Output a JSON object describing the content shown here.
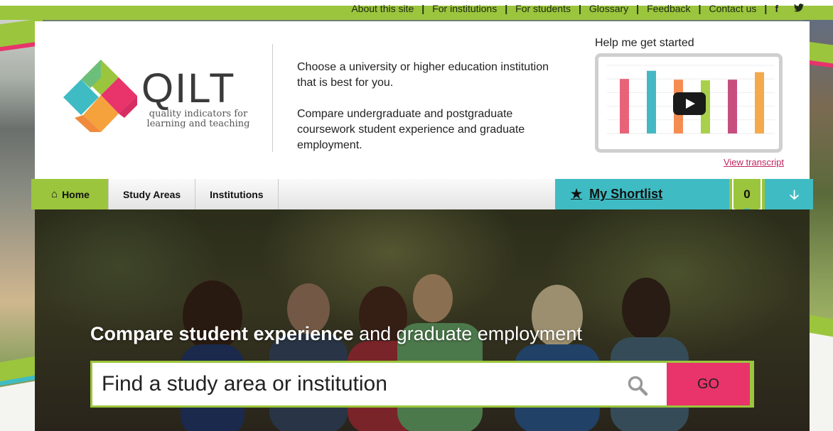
{
  "utility_nav": {
    "links": [
      "About this site",
      "For institutions",
      "For students",
      "Glossary",
      "Feedback",
      "Contact us"
    ],
    "social": [
      "f",
      "twitter"
    ]
  },
  "logo": {
    "wordmark": "QILT",
    "subtitle": "quality indicators for learning and teaching"
  },
  "intro": {
    "line1": "Choose a university or higher education institution that is best for you.",
    "line2": "Compare undergraduate and postgraduate coursework student experience and graduate employment."
  },
  "help": {
    "title": "Help me get started",
    "transcript": "View transcript",
    "video_thumbnail_chart": {
      "type": "bar",
      "values": [
        80,
        92,
        79,
        78,
        79,
        90
      ],
      "colors": [
        "#e8637a",
        "#45b8c4",
        "#f58d52",
        "#a9d04a",
        "#c64f80",
        "#f5a94d"
      ]
    }
  },
  "nav": {
    "home": "Home",
    "study_areas": "Study Areas",
    "institutions": "Institutions",
    "shortlist": "My Shortlist",
    "shortlist_count": "0"
  },
  "hero": {
    "title_bold": "Compare student experience",
    "title_rest": " and graduate employment",
    "search_placeholder": "Find a study area or institution",
    "go": "GO"
  },
  "colors": {
    "green": "#9bc53d",
    "teal": "#3fbcc3",
    "pink": "#e8336b"
  }
}
